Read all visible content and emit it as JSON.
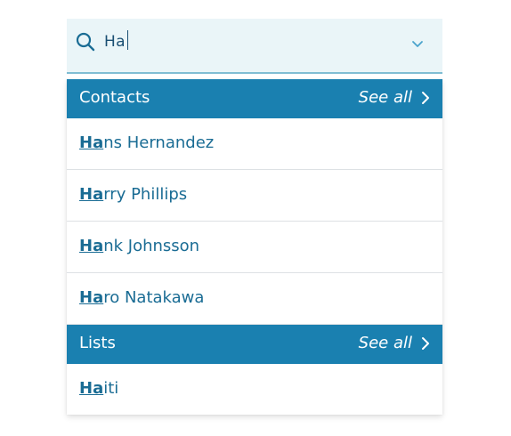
{
  "search": {
    "query": "Ha",
    "icon": "search-icon"
  },
  "colors": {
    "header_bg": "#1a80b0",
    "search_bg": "#eaf5f8",
    "result_text": "#1a6c94"
  },
  "sections": [
    {
      "title": "Contacts",
      "see_all_label": "See all",
      "items": [
        {
          "match": "Ha",
          "rest": "ns Hernandez"
        },
        {
          "match": "Ha",
          "rest": "rry Phillips"
        },
        {
          "match": "Ha",
          "rest": "nk Johnsson"
        },
        {
          "match": "Ha",
          "rest": "ro Natakawa"
        }
      ]
    },
    {
      "title": "Lists",
      "see_all_label": "See all",
      "items": [
        {
          "match": "Ha",
          "rest": "iti"
        }
      ]
    }
  ]
}
